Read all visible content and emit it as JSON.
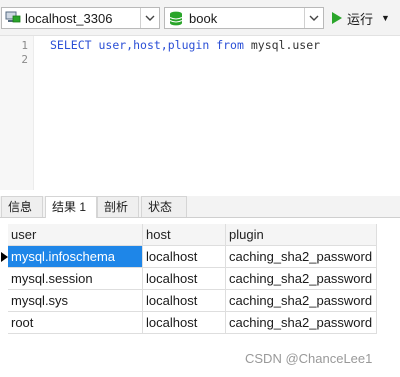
{
  "toolbar": {
    "connection": "localhost_3306",
    "database": "book",
    "run_label": "运行"
  },
  "editor": {
    "line_numbers": [
      "1",
      "2"
    ],
    "query": {
      "keyword_select": "SELECT",
      "columns": "user,host,plugin",
      "keyword_from": "from",
      "table": "mysql.user"
    }
  },
  "tabs": [
    {
      "label": "信息",
      "active": false
    },
    {
      "label": "结果 1",
      "active": true
    },
    {
      "label": "剖析",
      "active": false
    },
    {
      "label": "状态",
      "active": false
    }
  ],
  "results": {
    "columns": [
      "user",
      "host",
      "plugin"
    ],
    "rows": [
      [
        "mysql.infoschema",
        "localhost",
        "caching_sha2_password"
      ],
      [
        "mysql.session",
        "localhost",
        "caching_sha2_password"
      ],
      [
        "mysql.sys",
        "localhost",
        "caching_sha2_password"
      ],
      [
        "root",
        "localhost",
        "caching_sha2_password"
      ]
    ],
    "selected_row": 0
  },
  "watermark": "CSDN @ChanceLee1",
  "colors": {
    "selection": "#1e86e8",
    "run_icon": "#2aa52a",
    "database_icon": "#2aa52a",
    "keyword": "#2b4fd6"
  }
}
